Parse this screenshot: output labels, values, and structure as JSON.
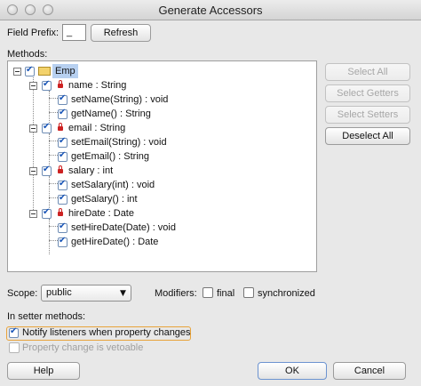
{
  "window": {
    "title": "Generate Accessors"
  },
  "field_prefix": {
    "label": "Field Prefix:",
    "value": "_"
  },
  "refresh_label": "Refresh",
  "methods_label": "Methods:",
  "tree": {
    "root": "Emp",
    "fields": [
      {
        "label": "name : String",
        "methods": [
          "setName(String) : void",
          "getName() : String"
        ]
      },
      {
        "label": "email : String",
        "methods": [
          "setEmail(String) : void",
          "getEmail() : String"
        ]
      },
      {
        "label": "salary : int",
        "methods": [
          "setSalary(int) : void",
          "getSalary() : int"
        ]
      },
      {
        "label": "hireDate : Date",
        "methods": [
          "setHireDate(Date) : void",
          "getHireDate() : Date"
        ]
      }
    ]
  },
  "side_buttons": {
    "select_all": "Select All",
    "select_getters": "Select Getters",
    "select_setters": "Select Setters",
    "deselect_all": "Deselect All"
  },
  "scope": {
    "label": "Scope:",
    "value": "public"
  },
  "modifiers": {
    "label": "Modifiers:",
    "final_label": "final",
    "synchronized_label": "synchronized"
  },
  "setter": {
    "section_label": "In setter methods:",
    "notify_label": "Notify listeners when property changes",
    "vetoable_label": "Property change is vetoable"
  },
  "footer": {
    "help": "Help",
    "ok": "OK",
    "cancel": "Cancel"
  },
  "colors": {
    "check": "#1a56b8",
    "lock": "#cc2222",
    "selection": "#b7d0f0",
    "focus_ring": "#e8a33a"
  }
}
